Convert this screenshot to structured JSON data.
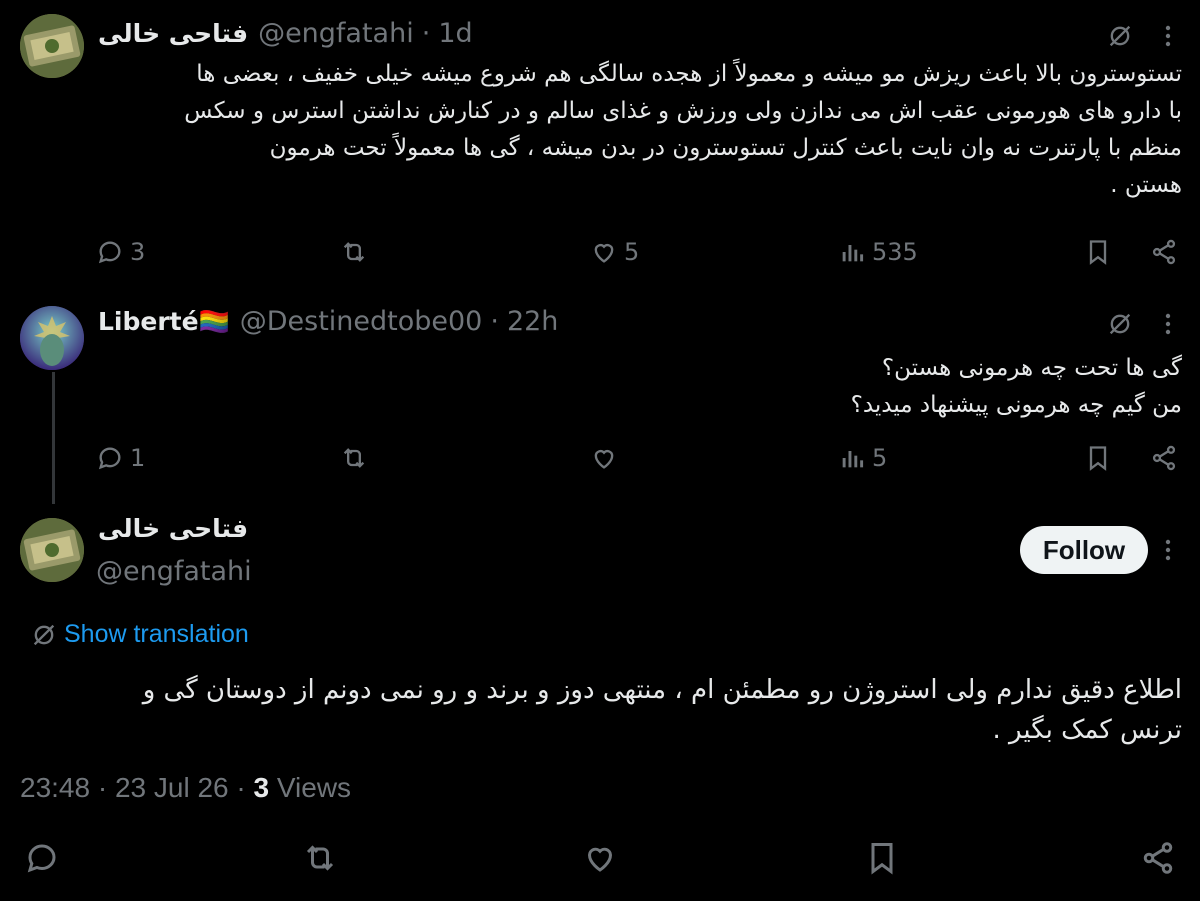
{
  "tweet1": {
    "display_name": "فتاحی خالی",
    "handle": "@engfatahi",
    "time": "1d",
    "lines": [
      "تستوسترون بالا باعث ریزش مو میشه و معمولاً از هجده سالگی هم شروع میشه خیلی خفیف ، بعضی ها",
      "با دارو های هورمونی عقب اش می ندازن ولی ورزش و غذای سالم و در کنارش نداشتن استرس و سکس",
      "منظم با پارتنرت نه وان نایت باعث کنترل تستوسترون در بدن میشه ، گی ها معمولاً تحت هرمون",
      "هستن ."
    ],
    "replies": "3",
    "likes": "5",
    "views": "535"
  },
  "tweet2": {
    "display_name": "Liberté🏳️‍🌈",
    "handle": "@Destinedtobe00",
    "time": "22h",
    "lines": [
      "گی ها تحت چه هرمونی هستن؟",
      "من گیم چه هرمونی پیشنهاد میدید؟"
    ],
    "replies": "1",
    "views": "5"
  },
  "main_tweet": {
    "display_name": "فتاحی خالی",
    "handle": "@engfatahi",
    "follow_label": "Follow",
    "show_translation": "Show translation",
    "lines": [
      "اطلاع دقیق ندارم ولی استروژن رو مطمئن ام ، منتهی دوز و برند و رو نمی دونم از دوستان گی و",
      "ترنس کمک بگیر ."
    ],
    "time": "23:48",
    "date": "23 Jul 26",
    "view_count": "3",
    "views_label": "Views"
  },
  "colors": {
    "muted": "#71767b",
    "link": "#1d9bf0",
    "text": "#e7e9ea"
  }
}
